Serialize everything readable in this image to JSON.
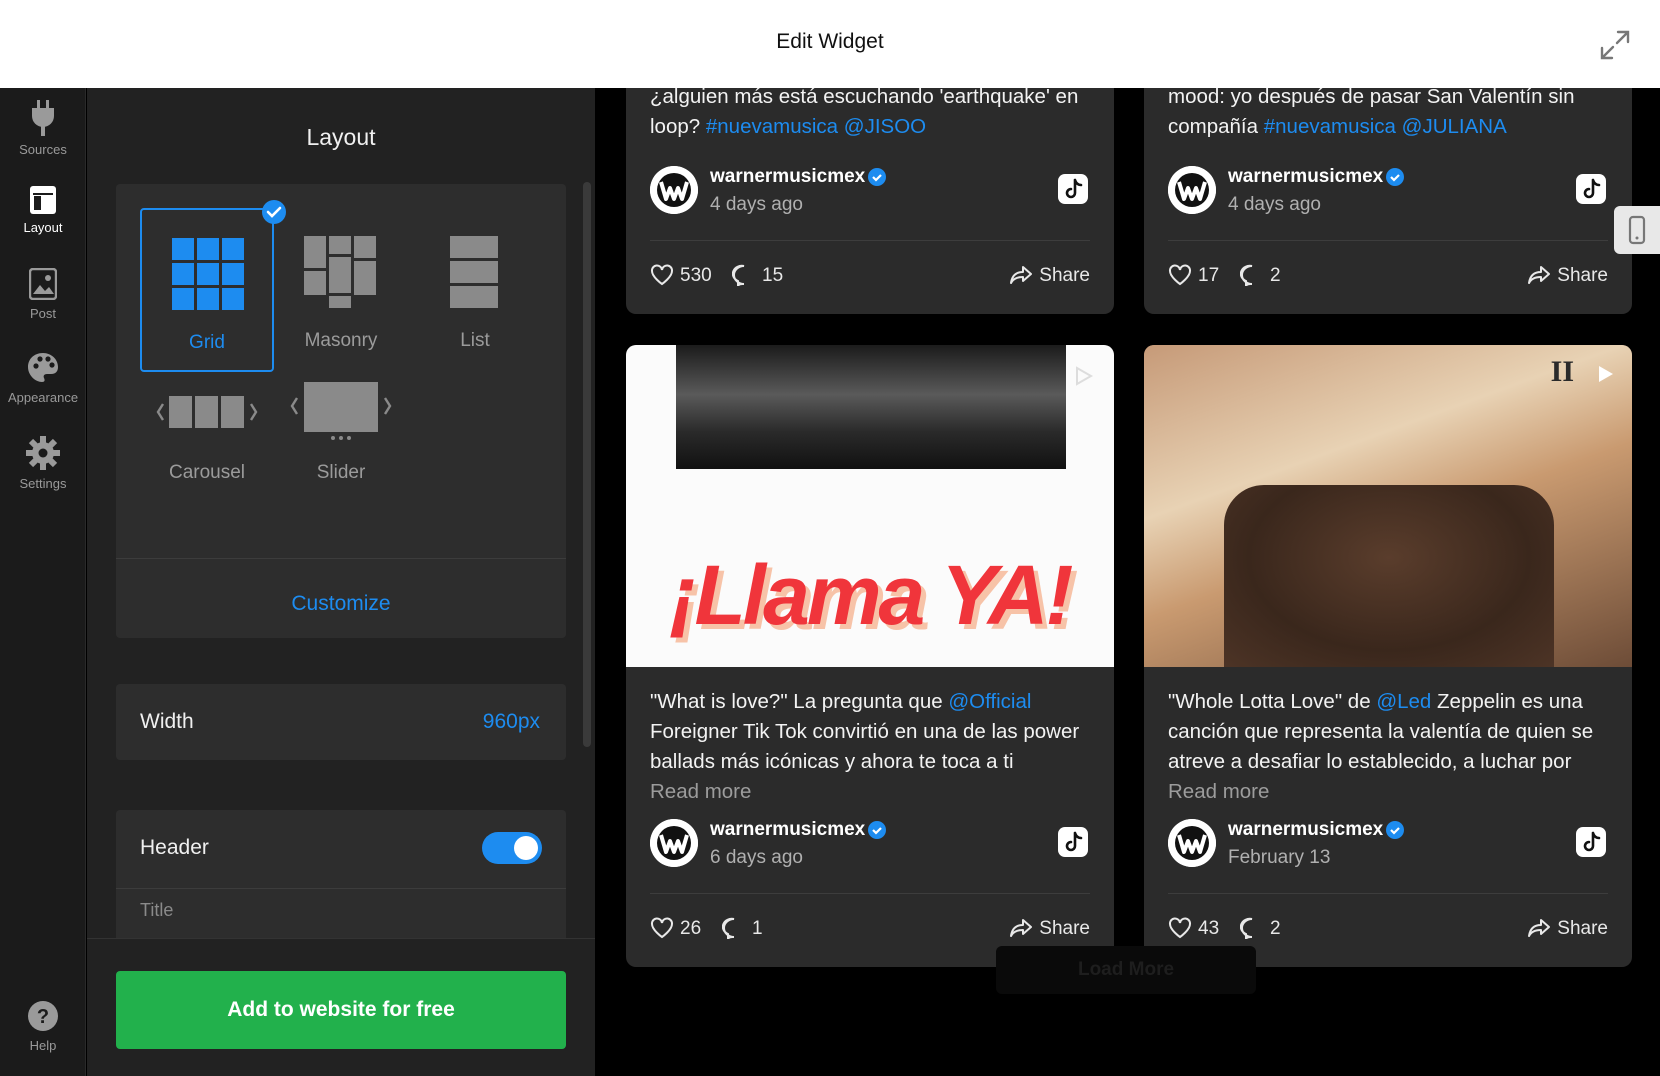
{
  "topbar": {
    "title": "Edit Widget",
    "expand_icon": "expand-icon"
  },
  "rail": {
    "items": [
      {
        "label": "Sources",
        "icon": "plug-icon",
        "active": false
      },
      {
        "label": "Layout",
        "icon": "layout-icon",
        "active": true
      },
      {
        "label": "Post",
        "icon": "image-icon",
        "active": false
      },
      {
        "label": "Appearance",
        "icon": "palette-icon",
        "active": false
      },
      {
        "label": "Settings",
        "icon": "gear-icon",
        "active": false
      }
    ],
    "help": {
      "label": "Help",
      "icon": "help-icon"
    }
  },
  "panel": {
    "title": "Layout",
    "layouts": [
      {
        "label": "Grid",
        "selected": true
      },
      {
        "label": "Masonry",
        "selected": false
      },
      {
        "label": "List",
        "selected": false
      },
      {
        "label": "Carousel",
        "selected": false
      },
      {
        "label": "Slider",
        "selected": false
      }
    ],
    "customize": "Customize",
    "width": {
      "label": "Width",
      "value": "960px"
    },
    "header": {
      "label": "Header",
      "enabled": true
    },
    "title_label": "Title",
    "add_button": "Add to website for free"
  },
  "feed": {
    "posts": [
      {
        "text": "¿alguien más está escuchando 'earthquake' en loop?",
        "tags": [
          "#nuevamusica",
          "@JISOO"
        ],
        "user": "warnermusicmex",
        "date": "4 days ago",
        "likes": "530",
        "comments": "15",
        "share": "Share"
      },
      {
        "text": "mood: yo después de pasar San Valentín sin compañía",
        "tags": [
          "#nuevamusica",
          "@JULIANA"
        ],
        "user": "warnermusicmex",
        "date": "4 days ago",
        "likes": "17",
        "comments": "2",
        "share": "Share"
      },
      {
        "image_text": "¡Llama YA!",
        "text_a": "\"What is love?\" La pregunta que",
        "mention": "@Official",
        "text_b": "Foreigner Tik Tok convirtió en una de las power ballads más icónicas y ahora te toca a ti",
        "read_more": "Read more",
        "user": "warnermusicmex",
        "date": "6 days ago",
        "likes": "26",
        "comments": "1",
        "share": "Share"
      },
      {
        "image_text": "II",
        "text_a": "\"Whole Lotta Love\" de",
        "mention": "@Led",
        "text_b": "Zeppelin es una canción que representa la valentía de quien se atreve a desafiar lo establecido, a luchar por",
        "read_more": "Read more",
        "user": "warnermusicmex",
        "date": "February 13",
        "likes": "43",
        "comments": "2",
        "share": "Share"
      }
    ],
    "load_more": "Load More"
  },
  "colors": {
    "accent": "#1d8cf0",
    "cta": "#22b14c",
    "panel": "#222222",
    "card": "#2b2b2b"
  }
}
